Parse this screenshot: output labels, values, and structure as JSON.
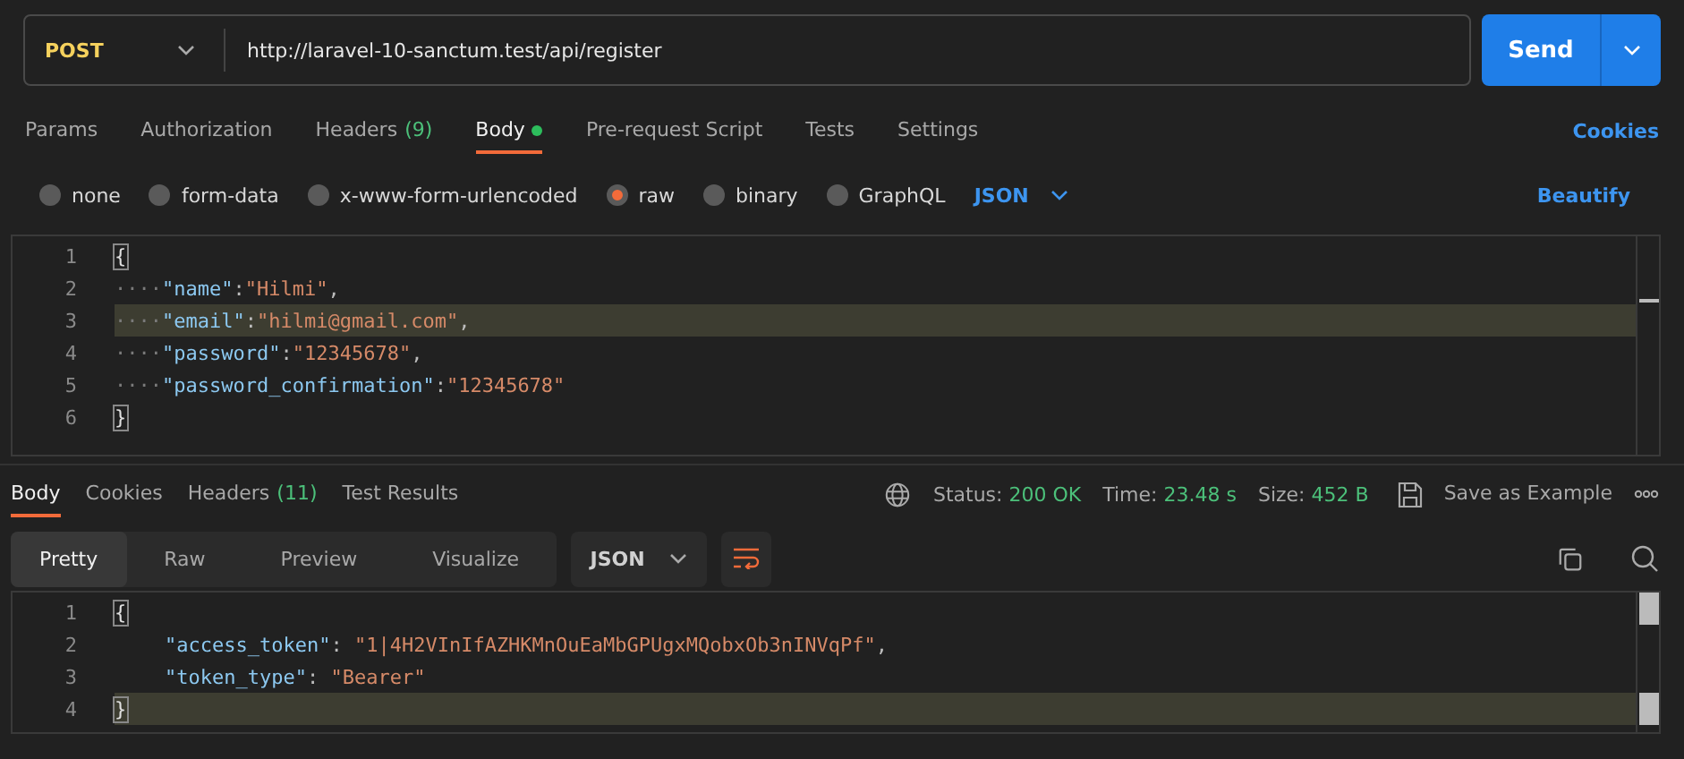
{
  "request": {
    "method": "POST",
    "url": "http://laravel-10-sanctum.test/api/register",
    "send_label": "Send"
  },
  "request_tabs": [
    {
      "label": "Params",
      "dot": false,
      "selected": false
    },
    {
      "label": "Authorization",
      "dot": false,
      "selected": false
    },
    {
      "label": "Headers",
      "count": "(9)",
      "dot": false,
      "selected": false
    },
    {
      "label": "Body",
      "dot": true,
      "selected": true
    },
    {
      "label": "Pre-request Script",
      "dot": false,
      "selected": false
    },
    {
      "label": "Tests",
      "dot": false,
      "selected": false
    },
    {
      "label": "Settings",
      "dot": false,
      "selected": false
    }
  ],
  "cookies_link": "Cookies",
  "body_types": [
    {
      "label": "none",
      "selected": false
    },
    {
      "label": "form-data",
      "selected": false
    },
    {
      "label": "x-www-form-urlencoded",
      "selected": false
    },
    {
      "label": "raw",
      "selected": true
    },
    {
      "label": "binary",
      "selected": false
    },
    {
      "label": "GraphQL",
      "selected": false
    }
  ],
  "raw_format": "JSON",
  "beautify_link": "Beautify",
  "request_body": [
    {
      "number": "1",
      "highlighted": false,
      "tokens": [
        {
          "kind": "brace",
          "text": "{"
        }
      ]
    },
    {
      "number": "2",
      "highlighted": false,
      "tokens": [
        {
          "kind": "whitespace",
          "text": "····"
        },
        {
          "kind": "key",
          "text": "\"name\""
        },
        {
          "kind": "punct",
          "text": ":"
        },
        {
          "kind": "string",
          "text": "\"Hilmi\""
        },
        {
          "kind": "punct",
          "text": ","
        }
      ]
    },
    {
      "number": "3",
      "highlighted": true,
      "tokens": [
        {
          "kind": "whitespace",
          "text": "····"
        },
        {
          "kind": "key",
          "text": "\"email\""
        },
        {
          "kind": "punct",
          "text": ":"
        },
        {
          "kind": "string",
          "text": "\"hilmi@gmail.com\""
        },
        {
          "kind": "punct",
          "text": ","
        }
      ]
    },
    {
      "number": "4",
      "highlighted": false,
      "tokens": [
        {
          "kind": "whitespace",
          "text": "····"
        },
        {
          "kind": "key",
          "text": "\"password\""
        },
        {
          "kind": "punct",
          "text": ":"
        },
        {
          "kind": "string",
          "text": "\"12345678\""
        },
        {
          "kind": "punct",
          "text": ","
        }
      ]
    },
    {
      "number": "5",
      "highlighted": false,
      "tokens": [
        {
          "kind": "whitespace",
          "text": "····"
        },
        {
          "kind": "key",
          "text": "\"password_confirmation\""
        },
        {
          "kind": "punct",
          "text": ":"
        },
        {
          "kind": "string",
          "text": "\"12345678\""
        }
      ]
    },
    {
      "number": "6",
      "highlighted": false,
      "tokens": [
        {
          "kind": "brace",
          "text": "}"
        }
      ]
    }
  ],
  "response_tabs": [
    {
      "label": "Body",
      "selected": true
    },
    {
      "label": "Cookies",
      "selected": false
    },
    {
      "label": "Headers",
      "count": "(11)",
      "selected": false
    },
    {
      "label": "Test Results",
      "selected": false
    }
  ],
  "response_meta": [
    {
      "label": "Status:",
      "value": "200 OK"
    },
    {
      "label": "Time:",
      "value": "23.48 s"
    },
    {
      "label": "Size:",
      "value": "452 B"
    }
  ],
  "save_example": "Save as Example",
  "view_modes": [
    {
      "label": "Pretty",
      "selected": true
    },
    {
      "label": "Raw",
      "selected": false
    },
    {
      "label": "Preview",
      "selected": false
    },
    {
      "label": "Visualize",
      "selected": false
    }
  ],
  "response_format": "JSON",
  "response_body": [
    {
      "number": "1",
      "highlighted": false,
      "tokens": [
        {
          "kind": "brace",
          "text": "{"
        }
      ]
    },
    {
      "number": "2",
      "highlighted": false,
      "tokens": [
        {
          "kind": "key",
          "text": "\"access_token\""
        },
        {
          "kind": "punct",
          "text": ": "
        },
        {
          "kind": "string",
          "text": "\"1|4H2VInIfAZHKMnOuEaMbGPUgxMQobxOb3nINVqPf\""
        },
        {
          "kind": "punct",
          "text": ","
        }
      ]
    },
    {
      "number": "3",
      "highlighted": false,
      "tokens": [
        {
          "kind": "key",
          "text": "\"token_type\""
        },
        {
          "kind": "punct",
          "text": ": "
        },
        {
          "kind": "string",
          "text": "\"Bearer\""
        }
      ]
    },
    {
      "number": "4",
      "highlighted": true,
      "tokens": [
        {
          "kind": "brace",
          "text": "}"
        }
      ]
    }
  ]
}
